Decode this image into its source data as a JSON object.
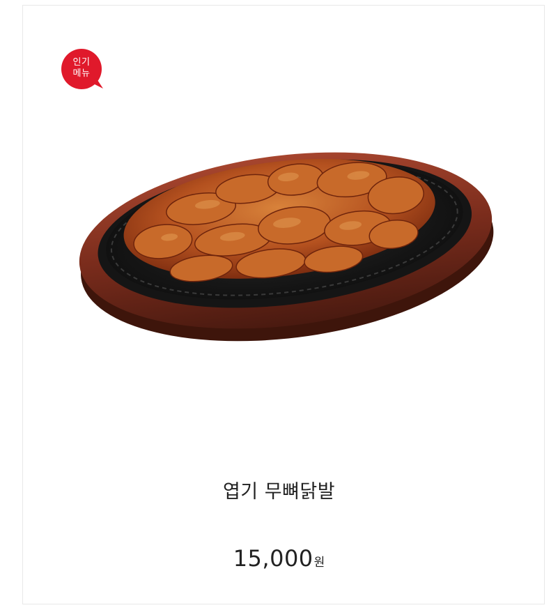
{
  "badge": {
    "line1": "인기",
    "line2": "메뉴",
    "color": "#e0192b"
  },
  "product": {
    "name": "엽기 무뼈닭발",
    "price": "15,000",
    "currency": "원",
    "image": "sizzling-plate-boneless-chicken-feet"
  }
}
